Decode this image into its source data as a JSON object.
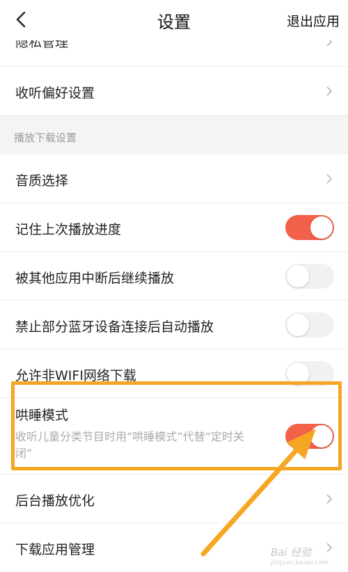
{
  "header": {
    "title": "设置",
    "exit_label": "退出应用"
  },
  "partial_item": {
    "label": "隐私管理"
  },
  "listen_pref": {
    "label": "收听偏好设置"
  },
  "section": {
    "label": "播放下载设置"
  },
  "items": [
    {
      "label": "音质选择",
      "type": "chevron"
    },
    {
      "label": "记住上次播放进度",
      "type": "toggle",
      "on": true
    },
    {
      "label": "被其他应用中断后继续播放",
      "type": "toggle",
      "on": false
    },
    {
      "label": "禁止部分蓝牙设备连接后自动播放",
      "type": "toggle",
      "on": false
    },
    {
      "label": "允许非WIFI网络下载",
      "type": "toggle",
      "on": false
    }
  ],
  "sleep_mode": {
    "label": "哄睡模式",
    "description": "收听儿童分类节目时用“哄睡模式”代替“定时关闭”",
    "on": true
  },
  "bottom_items": [
    {
      "label": "后台播放优化"
    },
    {
      "label": "下载应用管理"
    }
  ],
  "watermark": {
    "text": "Bai 经验",
    "sub": "jingyan.baidu.com"
  },
  "colors": {
    "toggle_on": "#f2614a",
    "toggle_off": "#f1f1f1",
    "highlight": "#f5a623",
    "section_bg": "#f4f4f4"
  },
  "icons": {
    "back": "chevron-left-icon",
    "row": "chevron-right-icon",
    "annotation": "arrow-icon"
  }
}
